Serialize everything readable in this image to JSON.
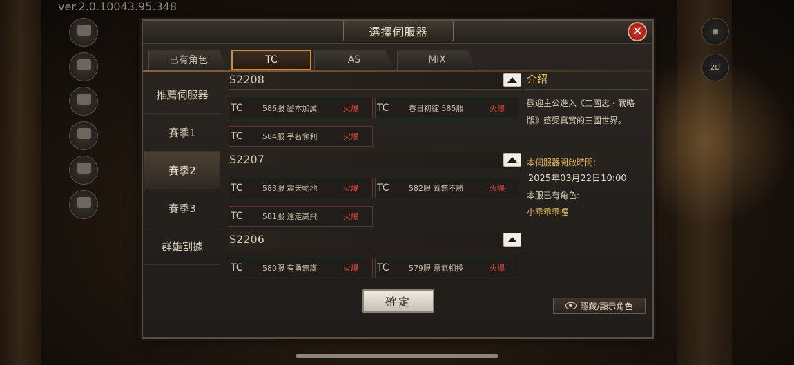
{
  "version_text": "ver.2.0.10043.95.348",
  "dialog": {
    "title": "選擇伺服器",
    "close_label": "✕",
    "tabs": [
      {
        "label": "已有角色",
        "active": false
      },
      {
        "label": "TC",
        "active": true
      },
      {
        "label": "AS",
        "active": false
      },
      {
        "label": "MIX",
        "active": false
      }
    ],
    "seasons": [
      {
        "label": "推薦伺服器",
        "active": false
      },
      {
        "label": "賽季1",
        "active": false
      },
      {
        "label": "賽季2",
        "active": true
      },
      {
        "label": "賽季3",
        "active": false
      },
      {
        "label": "群雄割據",
        "active": false
      }
    ],
    "groups": [
      {
        "name": "S2208",
        "servers": [
          {
            "region": "TC",
            "name": "586服  變本加厲",
            "status": "火爆"
          },
          {
            "region": "TC",
            "name": "春日初綻 585服",
            "status": "火爆"
          },
          {
            "region": "TC",
            "name": "584服  爭名奪利",
            "status": "火爆"
          }
        ]
      },
      {
        "name": "S2207",
        "servers": [
          {
            "region": "TC",
            "name": "583服  震天動地",
            "status": "火爆"
          },
          {
            "region": "TC",
            "name": "582服  戰無不勝",
            "status": "火爆"
          },
          {
            "region": "TC",
            "name": "581服  遠走高飛",
            "status": "火爆"
          }
        ]
      },
      {
        "name": "S2206",
        "servers": [
          {
            "region": "TC",
            "name": "580服  有勇無謀",
            "status": "火爆"
          },
          {
            "region": "TC",
            "name": "579服  意氣相投",
            "status": "火爆"
          }
        ]
      }
    ],
    "intro": {
      "title": "介紹",
      "body": "歡迎主公進入《三國志・戰略版》感受真實的三國世界。",
      "open_time_label": "本伺服器開啟時間:",
      "open_time": "2025年03月22日10:00",
      "role_label": "本服已有角色:",
      "role_name": "小乖乖乖喔"
    },
    "confirm_label": "確定",
    "hide_show_label": "隱藏/顯示角色"
  },
  "colors": {
    "accent_orange": "#d58a3a",
    "status_red": "#e0473d",
    "gold_text": "#e5b864"
  }
}
